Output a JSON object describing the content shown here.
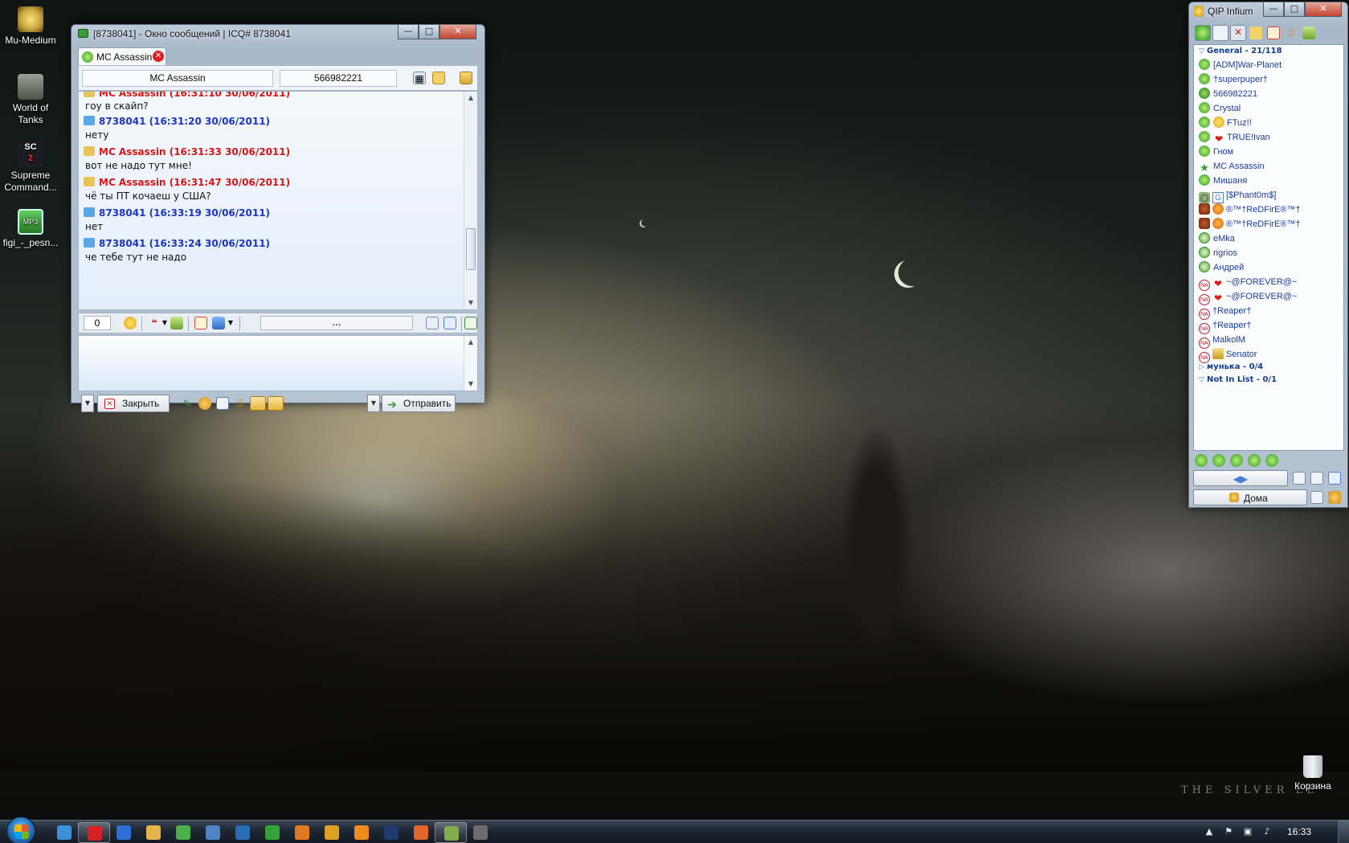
{
  "desktop": {
    "icons": [
      {
        "label": "Mu-Medium",
        "color": "#c9a640"
      },
      {
        "label": "World of Tanks",
        "color": "#6f7466"
      },
      {
        "label": "Supreme Command...",
        "color": "#2b2b35"
      },
      {
        "label": "figi_-_pesn...",
        "color": "#3a8f3a"
      }
    ],
    "recycle_bin": "Корзина",
    "wallpaper_caption": "THE SILVER LE"
  },
  "chat_window": {
    "title": "[8738041] - Окно сообщений | ICQ# 8738041",
    "tab_label": "MC Assassin",
    "contact_name": "MC Assassin",
    "contact_uin": "566982221",
    "partial_header": "MC Assassin (16:31:10 30/06/2011)",
    "messages": [
      {
        "header": "",
        "text": "гоу в скайп?",
        "self": false
      },
      {
        "header": "8738041 (16:31:20 30/06/2011)",
        "text": "нету",
        "self": true
      },
      {
        "header": "MC Assassin (16:31:33 30/06/2011)",
        "text": "вот не надо тут мне!",
        "self": false
      },
      {
        "header": "MC Assassin (16:31:47 30/06/2011)",
        "text": "чё ты ПТ кочаеш у США?",
        "self": false
      },
      {
        "header": "8738041 (16:33:19 30/06/2011)",
        "text": "нет",
        "self": true
      },
      {
        "header": "8738041 (16:33:24 30/06/2011)",
        "text": "че тебе тут не надо",
        "self": true
      }
    ],
    "char_counter": "0",
    "status_combo": "...",
    "close_label": "Закрыть",
    "send_label": "Отправить",
    "colors": {
      "self": "#1a35c8",
      "other": "#d81616"
    }
  },
  "qip": {
    "title": "QIP Infium",
    "groups": [
      {
        "name": "General - 21/118",
        "expanded": true
      },
      {
        "name": "мунька - 0/4",
        "expanded": false
      },
      {
        "name": "Not In List - 0/1",
        "expanded": true
      }
    ],
    "contacts": [
      {
        "name": "[ADM]War-Planet",
        "status": "online",
        "extra": ""
      },
      {
        "name": "†superpuper†",
        "status": "online",
        "extra": ""
      },
      {
        "name": "566982221",
        "status": "online-sub",
        "extra": ""
      },
      {
        "name": "Crystal",
        "status": "online",
        "extra": ""
      },
      {
        "name": "FTuz!!",
        "status": "online",
        "extra": "smile"
      },
      {
        "name": "TRUE!Ivan",
        "status": "online",
        "extra": "heart"
      },
      {
        "name": "Гном",
        "status": "online",
        "extra": ""
      },
      {
        "name": "MC Assassin",
        "status": "star",
        "extra": ""
      },
      {
        "name": "Мишаня",
        "status": "online",
        "extra": ""
      },
      {
        "name": "[$Phant0m$]",
        "status": "glasses",
        "extra": "g"
      },
      {
        "name": "®™†ReDFirE®™†",
        "status": "angry",
        "extra": "smile"
      },
      {
        "name": "®™†ReDFirE®™†",
        "status": "angry",
        "extra": "smile"
      },
      {
        "name": "eMka",
        "status": "away",
        "extra": ""
      },
      {
        "name": "rigrios",
        "status": "away",
        "extra": ""
      },
      {
        "name": "Андрей",
        "status": "away",
        "extra": ""
      },
      {
        "name": "~@FOREVER@~",
        "status": "na",
        "extra": "heart"
      },
      {
        "name": "~@FOREVER@~",
        "status": "na",
        "extra": "heart"
      },
      {
        "name": "†Reaper†",
        "status": "na",
        "extra": ""
      },
      {
        "name": "†Reaper†",
        "status": "na",
        "extra": ""
      },
      {
        "name": "MalkolM",
        "status": "na",
        "extra": ""
      },
      {
        "name": "Senator",
        "status": "na",
        "extra": "book"
      }
    ],
    "location_label": "Дома"
  },
  "taskbar": {
    "clock": "16:33",
    "apps": [
      {
        "name": "x-app",
        "color": "#3f8fd8",
        "active": false
      },
      {
        "name": "opera",
        "color": "#d62222",
        "active": true
      },
      {
        "name": "flash-app",
        "color": "#2f6fd8",
        "active": false
      },
      {
        "name": "folder",
        "color": "#e2b44a",
        "active": false
      },
      {
        "name": "chat-app",
        "color": "#4bb04b",
        "active": false
      },
      {
        "name": "pen-app",
        "color": "#4e84c4",
        "active": false
      },
      {
        "name": "cross-app",
        "color": "#2a6db5",
        "active": false
      },
      {
        "name": "utorrent",
        "color": "#35a235",
        "active": false
      },
      {
        "name": "firefox",
        "color": "#e07a1f",
        "active": false
      },
      {
        "name": "h-app",
        "color": "#e0a020",
        "active": false
      },
      {
        "name": "vlc",
        "color": "#f08a1c",
        "active": false
      },
      {
        "name": "photoshop",
        "color": "#1f3a6e",
        "active": false
      },
      {
        "name": "q-app",
        "color": "#e2662b",
        "active": false
      },
      {
        "name": "qip-taskbar",
        "color": "#7fae4a",
        "active": true
      },
      {
        "name": "tank-app",
        "color": "#6c6c6c",
        "active": false
      }
    ]
  }
}
